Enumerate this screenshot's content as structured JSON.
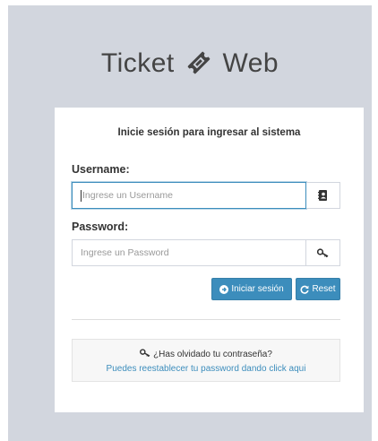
{
  "app": {
    "title_left": "Ticket",
    "title_right": "Web"
  },
  "login": {
    "message": "Inicie sesión para ingresar al sistema",
    "username_label": "Username:",
    "username_placeholder": "Ingrese un Username",
    "password_label": "Password:",
    "password_placeholder": "Ingrese un Password",
    "login_button": "Iniciar sesión",
    "reset_button": "Reset",
    "forgot_question": "¿Has olvidado tu contraseña?",
    "forgot_link": "Puedes reestablecer tu password dando click aqui"
  },
  "icons": {
    "logo": "ticket-icon",
    "username_addon": "address-book-icon",
    "password_addon": "key-icon",
    "login_button": "arrow-circle-icon",
    "reset_button": "refresh-icon",
    "forgot": "key-icon"
  },
  "colors": {
    "background": "#d2d6de",
    "primary": "#3c8dbc",
    "link": "#3c8dbc"
  }
}
